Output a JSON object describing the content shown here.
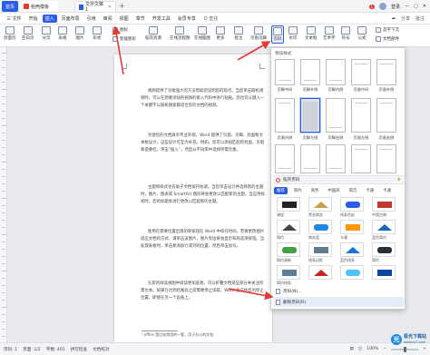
{
  "titlebar": {
    "tabs": [
      {
        "label": "首页"
      },
      {
        "label": "稻壳模板"
      },
      {
        "label": "文字文稿1"
      }
    ],
    "badge": "1",
    "login": "登录"
  },
  "menubar": {
    "items": [
      "三 文件",
      "开始",
      "插入",
      "页面布局",
      "引用",
      "审阅",
      "视图",
      "章节",
      "开发工具",
      "会员专享"
    ],
    "active_index": 2,
    "search": "Q 查找",
    "right": [
      "分享",
      "批注"
    ]
  },
  "ribbon": {
    "groups": [
      {
        "label": "封面页"
      },
      {
        "label": "空白页"
      },
      {
        "label": "分页"
      },
      {
        "label": "表格"
      },
      {
        "label": "图片"
      },
      {
        "label": "形状"
      },
      {
        "label": "图标"
      },
      {
        "label": "智能图形"
      },
      {
        "label": "稻壳资源"
      },
      {
        "label": "在线流程图"
      },
      {
        "label": "在线脑图"
      },
      {
        "label": "更多"
      },
      {
        "label": "批注"
      },
      {
        "label": "页眉页脚"
      },
      {
        "label": "页码"
      },
      {
        "label": "水印"
      },
      {
        "label": "文本框"
      },
      {
        "label": "艺术字"
      },
      {
        "label": "符号"
      },
      {
        "label": "公式"
      },
      {
        "label": "首字下沉"
      },
      {
        "label": "文档部件"
      }
    ],
    "small": [
      "截屏",
      "截图",
      "图表"
    ]
  },
  "document": {
    "paragraphs": [
      "视频提供了功能强大的方法帮助您证明您的观点。当您单击联机视频时，可以在想要添加的视频的嵌入代码中进行粘贴。您也可以键入一个关键字以联机搜索最适合您的文档的视频。",
      "为使您的文档具有专业外观，Word 提供了页眉、页脚、封面和文本框设计，这些设计可互为补充。例如，您可以添加匹配的封面、页眉和提要栏。单击“插入”，然后从不同库中选择所需元素。",
      "主题和样式也有助于文档保持协调。当您单击设计并选择新的主题时，图片、图表或 SmartArt 图形将会更改以匹配新的主题。当应用样式时，您的标题会进行更改以匹配新的主题。",
      "使用在需要位置出现的新按钮在 Word 中保存时间。若要更改图片适应文档的方式，请单击该图片，图片旁边将会显示布局选项按钮。当处理表格时，单击要添加行或列的位置，然后单击加号。",
      "在新的阅读视图中阅读更加容易。可以折叠文档某些部分并关注所需文本。如果在达到结尾处之前需要停止读取，Word 会记住您的停止位置，即使在另一个设备上。"
    ],
    "footnote": "¹ office 是比较常用的一套，用于办公的文档"
  },
  "panel": {
    "preset_title": "预设样式",
    "presets": [
      "页脚中间",
      "页脚外侧",
      "页脚内侧",
      "页眉中间",
      "页眉外侧",
      "页眉内侧",
      "页脚左侧",
      "页脚右侧",
      "页眉左侧",
      "页眉右侧"
    ],
    "bg_title": "稻壳页码",
    "categories": [
      "推荐",
      "简约",
      "商务",
      "中国风",
      "简洁",
      "卡通",
      "卡通"
    ],
    "active_category": 0,
    "swatches": [
      "课程",
      "黑金商务",
      "线条色彩",
      "中国古典",
      "简约",
      "商务蓝",
      "卡通",
      "蓝色简约",
      "简约清新",
      "线条边框",
      "蓝色线条",
      "简约",
      "简约线条",
      "",
      "",
      ""
    ],
    "swatch_colors": [
      "#222222",
      "#c8a04a",
      "#2b5ce6",
      "#c0392b",
      "#444444",
      "#1e88e5",
      "#ff9800",
      "#1565c0",
      "#43a047",
      "#607d8b",
      "#1976d2",
      "#263238",
      "#5f7d95",
      "#c62828",
      "#4fc3f7",
      "#0d47a1"
    ],
    "menu_rows": [
      "页码(N)...",
      "删除页码(R)"
    ],
    "highlight_row": 1
  },
  "statusbar": {
    "page": "页码: 1",
    "pages": "页面: 1/2",
    "words": "字数: 401",
    "spell": "拼写检查",
    "proofread": "文档校对",
    "zoom": "100%"
  },
  "watermark": {
    "line1": "极光下载站",
    "line2": "www.xz7.com"
  }
}
